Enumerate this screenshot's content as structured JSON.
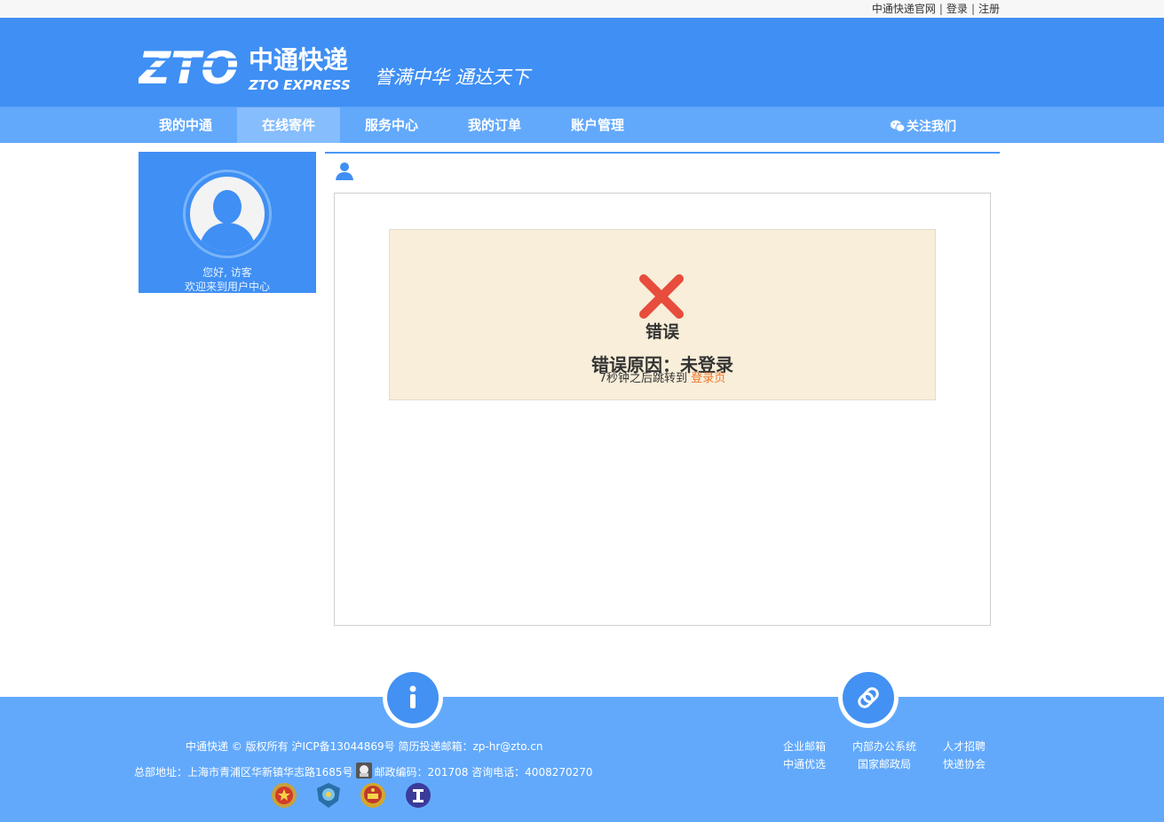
{
  "topbar": {
    "official_site": "中通快递官网",
    "login": "登录",
    "register": "注册",
    "separator": "|"
  },
  "header": {
    "logo_cn": "中通快递",
    "logo_en": "ZTO EXPRESS",
    "logo_letters": "ZTO",
    "slogan": "誉满中华 通达天下"
  },
  "nav": {
    "items": [
      {
        "label": "我的中通"
      },
      {
        "label": "在线寄件"
      },
      {
        "label": "服务中心"
      },
      {
        "label": "我的订单"
      },
      {
        "label": "账户管理"
      }
    ],
    "active_index": 1,
    "follow_us": "关注我们"
  },
  "sidebar": {
    "greeting": "您好, 访客",
    "welcome": "欢迎来到用户中心"
  },
  "error": {
    "title": "错误",
    "reason": "错误原因：未登录",
    "redirect_prefix": "7秒钟之后跳转到 ",
    "redirect_link": "登录页"
  },
  "footer": {
    "copyright": "中通快递 © 版权所有 沪ICP备13044869号 简历投递邮箱：zp-hr@zto.cn",
    "address_prefix": "总部地址：上海市青浦区华新镇华志路1685号",
    "address_suffix": "邮政编码：201708 咨询电话：4008270270",
    "links": [
      {
        "label": "企业邮箱"
      },
      {
        "label": "内部办公系统"
      },
      {
        "label": "人才招聘"
      },
      {
        "label": "中通优选"
      },
      {
        "label": "国家邮政局"
      },
      {
        "label": "快递协会"
      }
    ]
  },
  "colors": {
    "header_blue": "#3f8ff4",
    "nav_blue": "#62a9fc",
    "error_bg": "#f8eed9",
    "error_x": "#e74c3c",
    "link_orange": "#f0772a"
  },
  "icons": [
    "zto-logo",
    "wechat-icon",
    "user-icon",
    "error-x-icon",
    "info-icon",
    "link-icon",
    "police-emblem-icon",
    "cyber-police-icon",
    "national-emblem-icon",
    "postal-association-icon",
    "beian-icon"
  ]
}
